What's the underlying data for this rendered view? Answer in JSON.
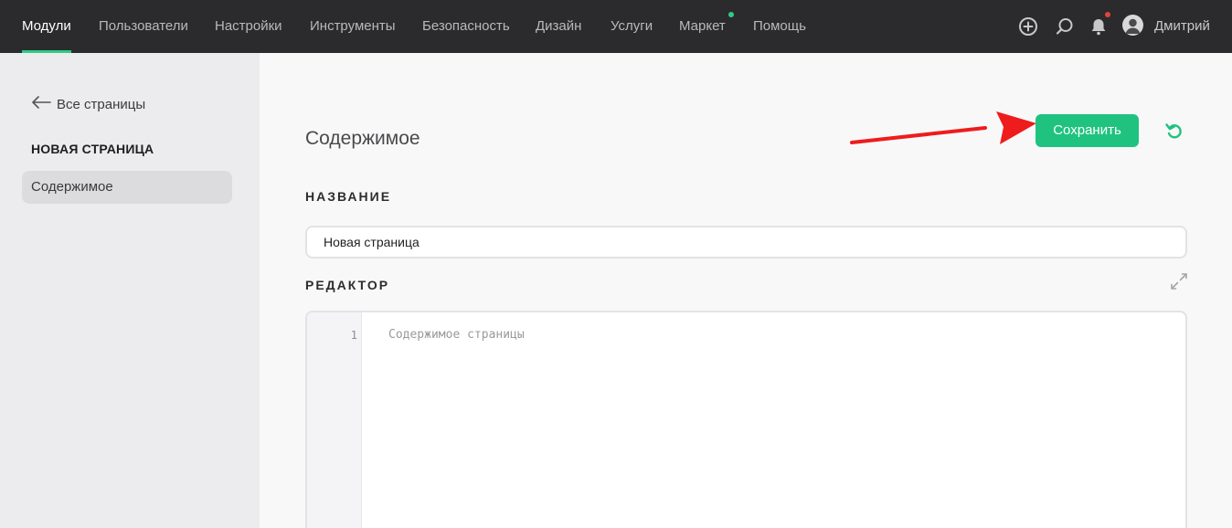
{
  "topnav": {
    "items": [
      {
        "label": "Модули",
        "active": true
      },
      {
        "label": "Пользователи"
      },
      {
        "label": "Настройки"
      },
      {
        "label": "Инструменты"
      },
      {
        "label": "Безопасность"
      },
      {
        "label": "Дизайн"
      },
      {
        "label": "Услуги"
      },
      {
        "label": "Маркет",
        "badge_color": "#2ecc87"
      },
      {
        "label": "Помощь"
      }
    ],
    "icons": [
      "plus-circle-icon",
      "search-icon",
      "bell-icon"
    ],
    "notification_badge_color": "#e0443e",
    "user_name": "Дмитрий"
  },
  "sidebar": {
    "back_label": "Все страницы",
    "page_heading": "НОВАЯ СТРАНИЦА",
    "items": [
      {
        "label": "Содержимое",
        "selected": true
      }
    ]
  },
  "main": {
    "section_title": "Содержимое",
    "save_label": "Сохранить",
    "name_label": "НАЗВАНИЕ",
    "name_value": "Новая страница",
    "editor_label": "РЕДАКТОР",
    "editor": {
      "line_number": "1",
      "placeholder": "Содержимое страницы"
    }
  },
  "colors": {
    "accent": "#1fc37f",
    "topbar_bg": "#2b2b2d",
    "annotation_arrow": "#ee1c1c"
  }
}
